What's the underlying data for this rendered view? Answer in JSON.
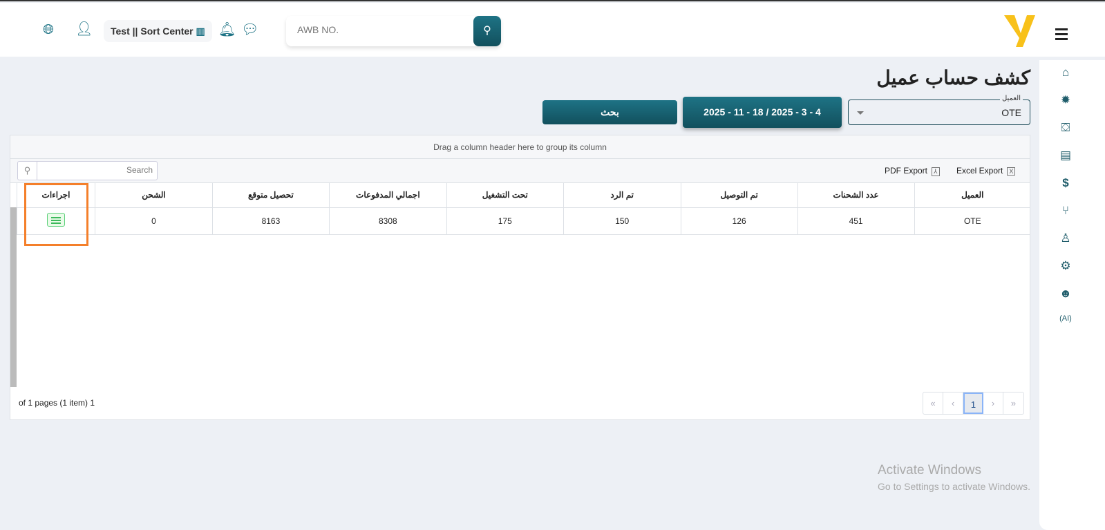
{
  "header": {
    "branch": "Test || Sort Center",
    "awb_placeholder": "AWB NO.",
    "icons": [
      "globe-icon",
      "user-icon",
      "building-icon",
      "bell-icon",
      "chat-icon",
      "search-icon",
      "menu-icon"
    ],
    "accent": "#1e7385",
    "logo_color": "#f8c11a"
  },
  "sidebar": {
    "items": [
      "home-icon",
      "new-badge-icon",
      "box-check-icon",
      "clipboard-icon",
      "dollar-icon",
      "branch-icon",
      "user-icon",
      "gear-icon",
      "agent-icon",
      "ai-headset-icon"
    ]
  },
  "page": {
    "title": "كشف حساب عميل",
    "client_label": "العميل",
    "client_value": "OTE",
    "date_range": "2025 - 11 - 18 / 2025 - 3 - 4",
    "search_button": "بحث"
  },
  "grid": {
    "group_hint": "Drag a column header here to group its column",
    "search_placeholder": "Search",
    "pdf_export": "PDF Export",
    "excel_export": "Excel Export",
    "columns": [
      "العميل",
      "عدد الشحنات",
      "تم التوصيل",
      "تم الرد",
      "تحت التشغيل",
      "اجمالي المدفوعات",
      "تحصيل متوقع",
      "الشحن",
      "اجراءات"
    ],
    "rows": [
      [
        "OTE",
        "451",
        "126",
        "150",
        "175",
        "8308",
        "8163",
        "0"
      ]
    ],
    "pager_info": "of 1 pages (1 item) 1",
    "pages": [
      "«",
      "‹",
      "1",
      "›",
      "»"
    ]
  },
  "watermark": {
    "title": "Activate Windows",
    "subtitle": "Go to Settings to activate Windows."
  }
}
